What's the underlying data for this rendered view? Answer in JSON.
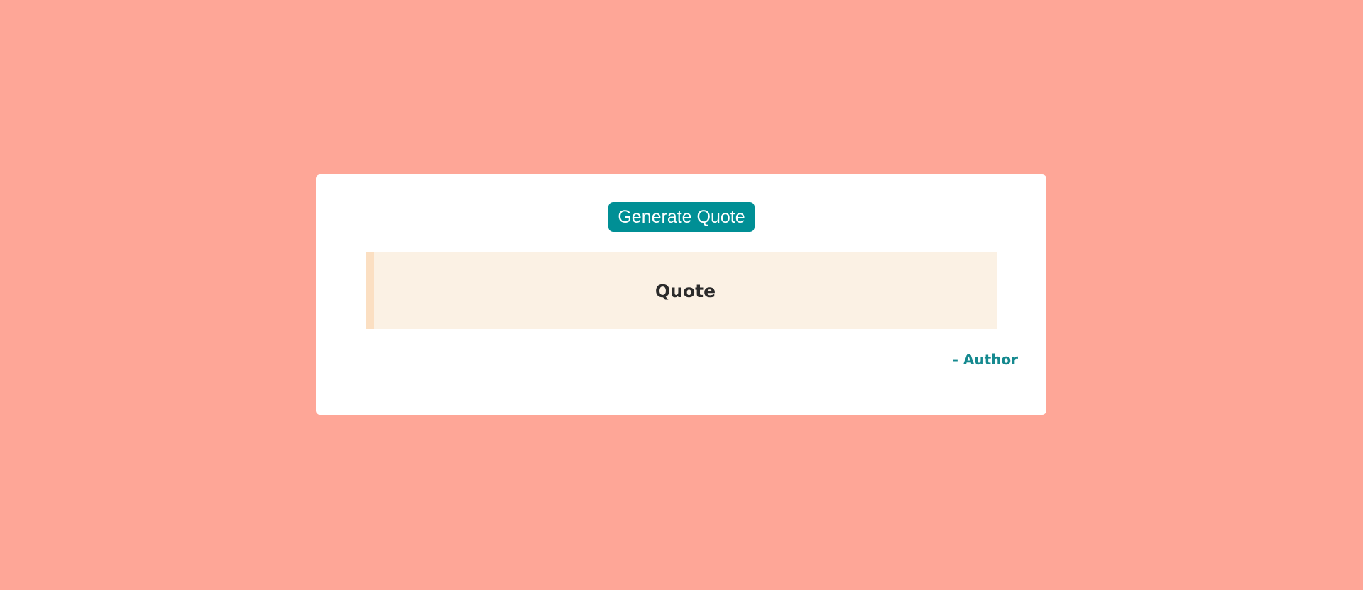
{
  "button": {
    "label": "Generate Quote"
  },
  "quote": {
    "text": "Quote"
  },
  "author": {
    "text": "- Author"
  },
  "colors": {
    "background": "#fea697",
    "accent": "#008f95",
    "quote_bg": "#fbf1e4",
    "quote_border": "#fbdfc2"
  }
}
